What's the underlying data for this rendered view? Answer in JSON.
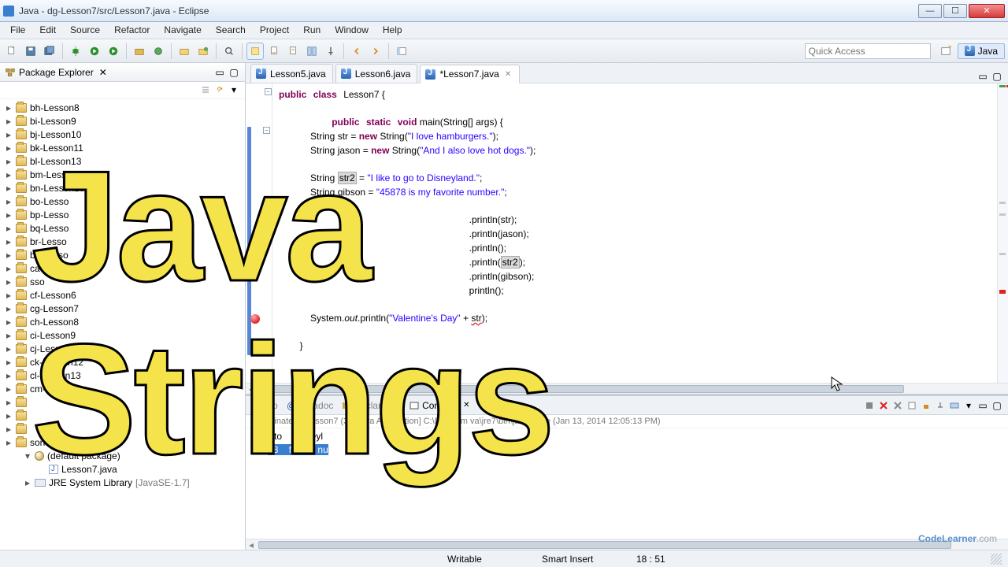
{
  "window": {
    "title": "Java - dg-Lesson7/src/Lesson7.java - Eclipse"
  },
  "menu": {
    "items": [
      "File",
      "Edit",
      "Source",
      "Refactor",
      "Navigate",
      "Search",
      "Project",
      "Run",
      "Window",
      "Help"
    ]
  },
  "toolbar": {
    "quick_access_placeholder": "Quick Access",
    "perspective_label": "Java"
  },
  "package_explorer": {
    "title": "Package Explorer",
    "projects": [
      "bh-Lesson8",
      "bi-Lesson9",
      "bj-Lesson10",
      "bk-Lesson11",
      "bl-Lesson13",
      "bm-Lesson14",
      "bn-Lesson15",
      "bo-Lesso",
      "bp-Lesso",
      "bq-Lesso",
      "br-Lesso",
      "bs-Lesso",
      "ca-Lesso",
      "  sso",
      "cf-Lesson6",
      "cg-Lesson7",
      "ch-Lesson8",
      "ci-Lesson9",
      "cj-Lesson10",
      "ck-Lesson12",
      "cl-Lesson13",
      "cm-L",
      "",
      "",
      "",
      "son6"
    ],
    "expanded": {
      "pkg_label": "(default package)",
      "java_file": "Lesson7.java",
      "jre_label": "JRE System Library",
      "jre_suffix": "[JavaSE-1.7]"
    }
  },
  "editor_tabs": [
    {
      "label": "Lesson5.java",
      "active": false
    },
    {
      "label": "Lesson6.java",
      "active": false
    },
    {
      "label": "*Lesson7.java",
      "active": true
    }
  ],
  "code": {
    "decl": {
      "kw1": "public",
      "kw2": "class",
      "name": "Lesson7",
      "open": " {"
    },
    "main": {
      "kw1": "public",
      "kw2": "static",
      "kw3": "void",
      "sig": " main(String[] args) {"
    },
    "l3a": "            String str = ",
    "l3n": "new",
    "l3b": " String(",
    "l3s": "\"I love hamburgers.\"",
    "l3c": ");",
    "l4a": "            String jason = ",
    "l4n": "new",
    "l4b": " String(",
    "l4s": "\"And I also love hot dogs.\"",
    "l4c": ");",
    "l6a": "            String ",
    "l6v": "str2",
    "l6b": " = ",
    "l6s": "\"I like to go to Disneyland.\"",
    "l6c": ";",
    "l7a": "            String gibson = ",
    "l7s": "\"45878 is my favorite number.\"",
    "l7c": ";",
    "p1": "            .println(str);",
    "p2": "            .println(jason);",
    "p3": "            .println();",
    "p4a": "            .println(",
    "p4v": "str2",
    "p4b": ");",
    "p5": "            .println(gibson);",
    "p6": "            println();",
    "l15a": "            System.",
    "l15o": "out",
    "l15b": ".println(",
    "l15s": "\"Valentine's Day\"",
    "l15c": " + ",
    "l15v": "str",
    "l15d": ");",
    "close": "        }"
  },
  "console": {
    "tabs": {
      "problems": "Pro",
      "javadoc": "Javadoc",
      "declaration": "Declaration",
      "console": "Console"
    },
    "term_line": "<terminated> Lesson7 (3) [Java Application] C:\\Program       va\\jre7\\bin\\javaw.exe (Jan 13, 2014 12:05:13 PM)",
    "out_lines": [
      "",
      "",
      "",
      "  lik   to    to    eyl",
      "458",
      "",
      "",
      ""
    ],
    "selected_fragment": "78"
  },
  "status": {
    "writable": "Writable",
    "insert": "Smart Insert",
    "pos": "18 : 51"
  },
  "overlays": {
    "line1": "Java",
    "line2": "Strings",
    "watermark_a": "CodeLearner",
    "watermark_b": ".com"
  },
  "colors": {
    "keyword": "#7f0055",
    "string": "#2a00ff",
    "highlight": "#e7f0fc"
  }
}
